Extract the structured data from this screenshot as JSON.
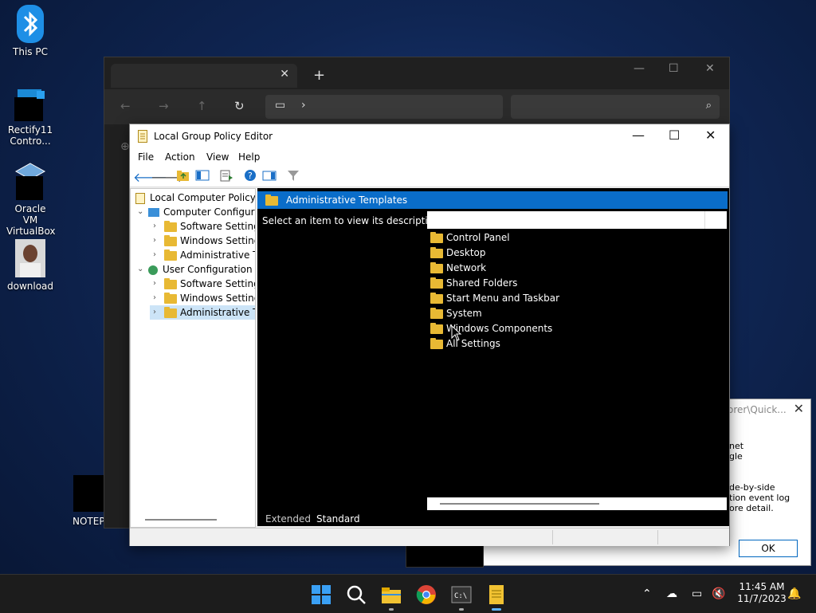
{
  "desktop": {
    "icons": [
      {
        "label": "This PC"
      },
      {
        "label": "Rectify11 Contro..."
      },
      {
        "label": "Oracle VM VirtualBox"
      },
      {
        "label": "download"
      },
      {
        "label": "NOTEPA"
      }
    ]
  },
  "gpedit": {
    "title": "Local Group Policy Editor",
    "menu": [
      "File",
      "Action",
      "View",
      "Help"
    ],
    "tree": [
      {
        "label": "Local Computer Policy"
      },
      {
        "label": "Computer Configura"
      },
      {
        "label": "Software Settings"
      },
      {
        "label": "Windows Setting"
      },
      {
        "label": "Administrative Te"
      },
      {
        "label": "User Configuration"
      },
      {
        "label": "Software Settings"
      },
      {
        "label": "Windows Setting"
      },
      {
        "label": "Administrative Te"
      }
    ],
    "header": "Administrative Templates",
    "description": "Select an item to view its description.",
    "items": [
      "Control Panel",
      "Desktop",
      "Network",
      "Shared Folders",
      "Start Menu and Taskbar",
      "System",
      "Windows Components",
      "All Settings"
    ],
    "tabs": [
      "Extended",
      "Standard"
    ]
  },
  "dialog2": {
    "title": "orer\\Quick...",
    "lines": [
      "net",
      "gle",
      "",
      "",
      "de-by-side",
      "tion event log",
      "ore detail."
    ],
    "ok_label": "OK"
  },
  "taskbar": {
    "time": "11:45 AM",
    "date": "11/7/2023"
  },
  "colors": {
    "selection_blue": "#0a6dc9",
    "folder_yellow": "#e8b934"
  }
}
